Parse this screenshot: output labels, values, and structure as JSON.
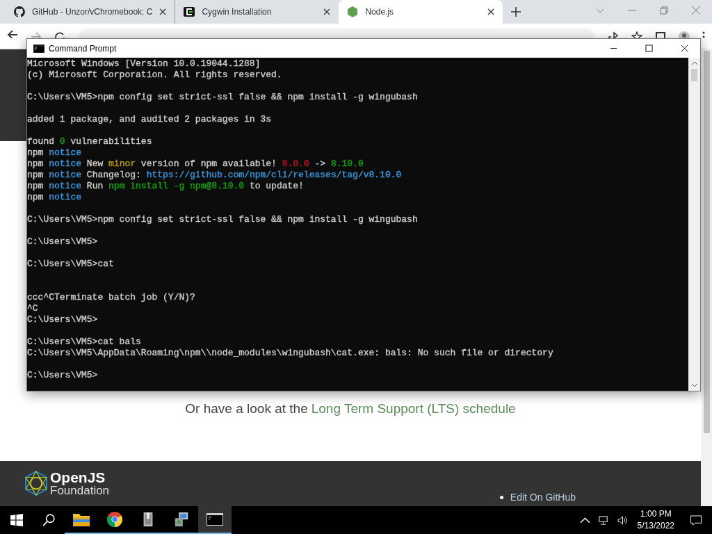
{
  "browser": {
    "tabs": [
      {
        "label": "GitHub - Unzor/vChromebook: C",
        "selected": false
      },
      {
        "label": "Cygwin Installation",
        "selected": false
      },
      {
        "label": "Node.js",
        "selected": true
      }
    ]
  },
  "page": {
    "lts_text": "Or have a look at the",
    "lts_link": "Long Term Support (LTS) schedule",
    "footer": {
      "logo_top": "OpenJS",
      "logo_bottom": "Foundation",
      "links": [
        "Edit On GitHub"
      ]
    }
  },
  "console": {
    "title": "Command Prompt",
    "lines": [
      {
        "kind": "text",
        "segments": [
          {
            "text": "Microsoft Windows [Version 10.0.19044.1288]",
            "color": "#cccccc"
          }
        ]
      },
      {
        "kind": "text",
        "segments": [
          {
            "text": "(c) Microsoft Corporation. All rights reserved.",
            "color": "#cccccc"
          }
        ]
      },
      {
        "kind": "blank"
      },
      {
        "kind": "text",
        "segments": [
          {
            "text": "C:\\Users\\VM5>npm config set strict-ssl false && npm install -g wingubash",
            "color": "#cccccc"
          }
        ]
      },
      {
        "kind": "blank"
      },
      {
        "kind": "text",
        "segments": [
          {
            "text": "added 1 package, and audited 2 packages in 3s",
            "color": "#cccccc"
          }
        ]
      },
      {
        "kind": "blank"
      },
      {
        "kind": "text",
        "segments": [
          {
            "text": "found ",
            "color": "#cccccc"
          },
          {
            "text": "0",
            "color": "#13a10e"
          },
          {
            "text": " vulnerabilities",
            "color": "#cccccc"
          }
        ]
      },
      {
        "kind": "text",
        "segments": [
          {
            "text": "npm ",
            "color": "#cccccc"
          },
          {
            "text": "notice",
            "color": "#3a96dd"
          }
        ]
      },
      {
        "kind": "text",
        "segments": [
          {
            "text": "npm ",
            "color": "#cccccc"
          },
          {
            "text": "notice",
            "color": "#3a96dd"
          },
          {
            "text": " New ",
            "color": "#cccccc"
          },
          {
            "text": "minor",
            "color": "#c19c00"
          },
          {
            "text": " version of npm available! ",
            "color": "#cccccc"
          },
          {
            "text": "8.8.0 ",
            "color": "#c50f1f"
          },
          {
            "text": "->",
            "color": "#cccccc"
          },
          {
            "text": " 8.10.0",
            "color": "#13a10e"
          }
        ]
      },
      {
        "kind": "text",
        "segments": [
          {
            "text": "npm ",
            "color": "#cccccc"
          },
          {
            "text": "notice",
            "color": "#3a96dd"
          },
          {
            "text": " Changelog: ",
            "color": "#cccccc"
          },
          {
            "text": "https://github.com/npm/cli/releases/tag/v8.10.0",
            "color": "#3a96dd"
          }
        ]
      },
      {
        "kind": "text",
        "segments": [
          {
            "text": "npm ",
            "color": "#cccccc"
          },
          {
            "text": "notice",
            "color": "#3a96dd"
          },
          {
            "text": " Run ",
            "color": "#cccccc"
          },
          {
            "text": "npm install -g npm@8.10.0",
            "color": "#13a10e"
          },
          {
            "text": " to update!",
            "color": "#cccccc"
          }
        ]
      },
      {
        "kind": "text",
        "segments": [
          {
            "text": "npm ",
            "color": "#cccccc"
          },
          {
            "text": "notice",
            "color": "#3a96dd"
          }
        ]
      },
      {
        "kind": "blank"
      },
      {
        "kind": "text",
        "segments": [
          {
            "text": "C:\\Users\\VM5>npm config set strict-ssl false && npm install -g wingubash",
            "color": "#cccccc"
          }
        ]
      },
      {
        "kind": "blank"
      },
      {
        "kind": "text",
        "segments": [
          {
            "text": "C:\\Users\\VM5>",
            "color": "#cccccc"
          }
        ]
      },
      {
        "kind": "blank"
      },
      {
        "kind": "text",
        "segments": [
          {
            "text": "C:\\Users\\VM5>cat",
            "color": "#cccccc"
          }
        ]
      },
      {
        "kind": "blank"
      },
      {
        "kind": "blank"
      },
      {
        "kind": "text",
        "segments": [
          {
            "text": "ccc^CTerminate batch job (Y/N)?",
            "color": "#cccccc"
          }
        ]
      },
      {
        "kind": "text",
        "segments": [
          {
            "text": "^C",
            "color": "#cccccc"
          }
        ]
      },
      {
        "kind": "text",
        "segments": [
          {
            "text": "C:\\Users\\VM5>",
            "color": "#cccccc"
          }
        ]
      },
      {
        "kind": "blank"
      },
      {
        "kind": "text",
        "segments": [
          {
            "text": "C:\\Users\\VM5>cat bals",
            "color": "#cccccc"
          }
        ]
      },
      {
        "kind": "text",
        "segments": [
          {
            "text": "C:\\Users\\VM5\\AppData\\Roaming\\npm\\\\node_modules\\wingubash\\cat.exe: bals: No such file or directory",
            "color": "#cccccc"
          }
        ]
      },
      {
        "kind": "blank"
      },
      {
        "kind": "text",
        "segments": [
          {
            "text": "C:\\Users\\VM5>",
            "color": "#cccccc"
          }
        ]
      }
    ]
  },
  "taskbar": {
    "apps": [
      {
        "selected": false
      },
      {
        "selected": false
      },
      {
        "selected": false
      },
      {
        "selected": false
      },
      {
        "selected": true
      }
    ],
    "time": "1:00 PM",
    "date": "5/13/2022"
  }
}
